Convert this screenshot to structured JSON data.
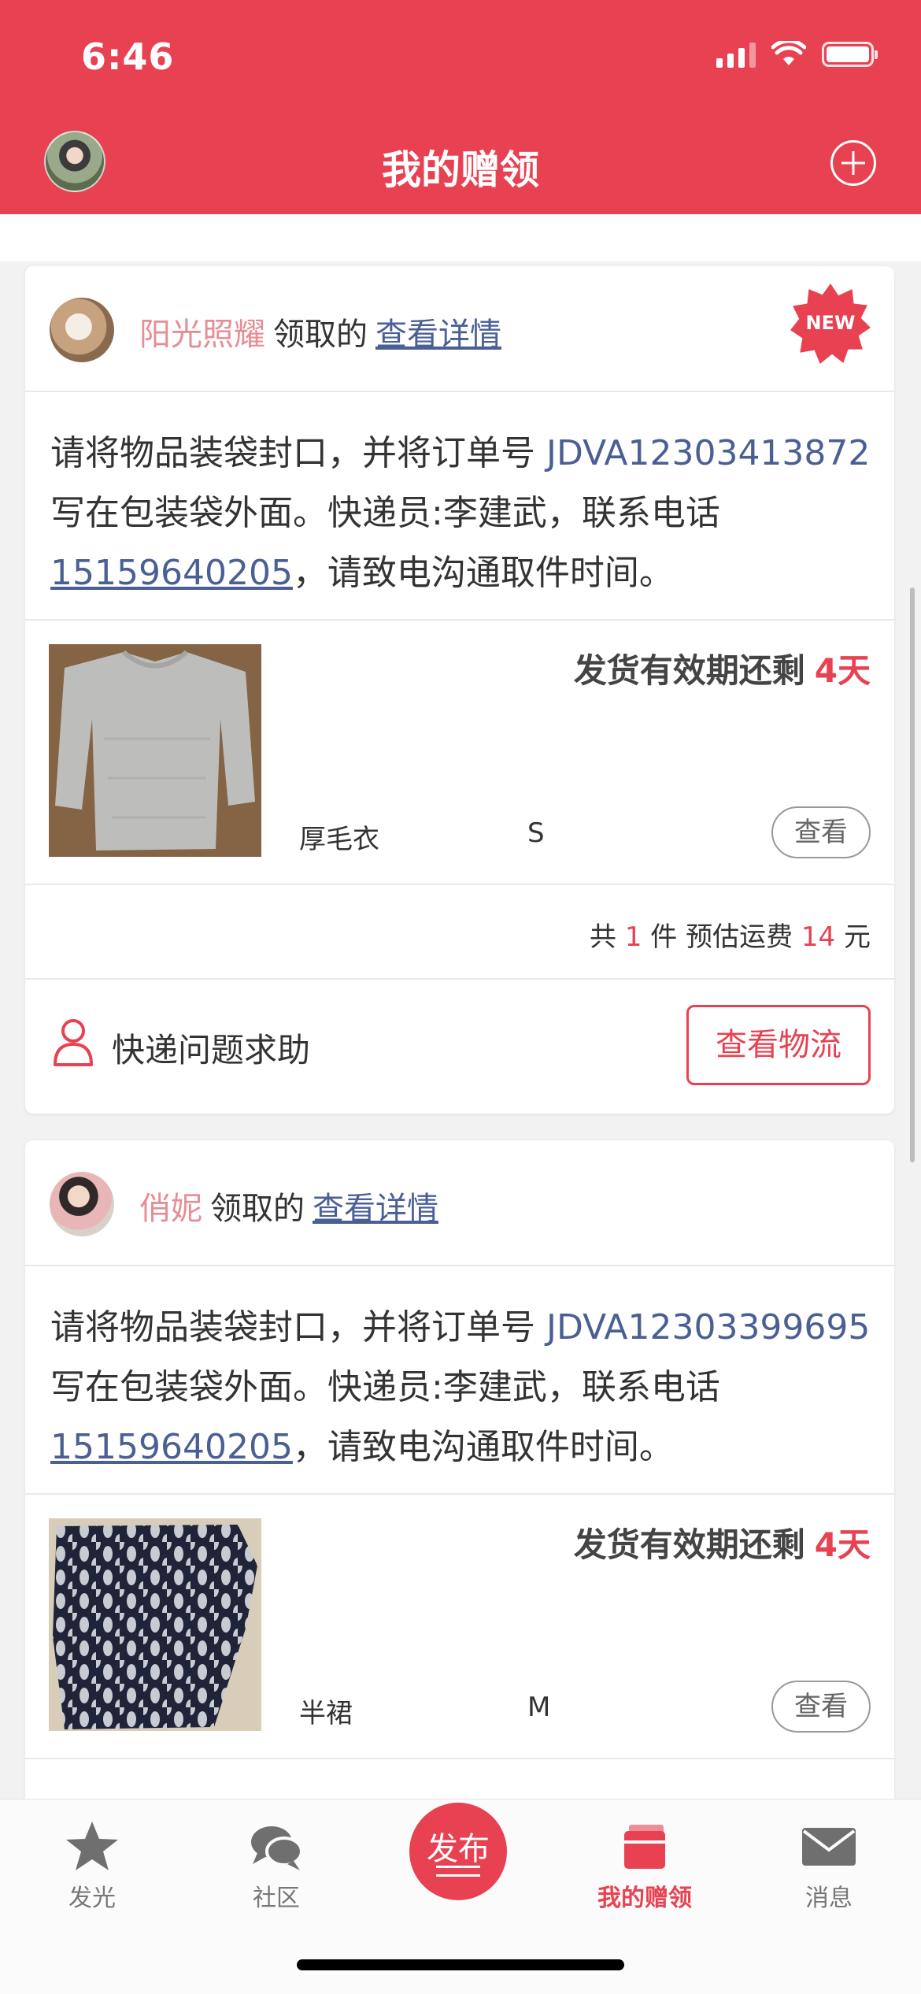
{
  "status_bar": {
    "time": "6:46"
  },
  "header": {
    "title": "我的赠领"
  },
  "cards": [
    {
      "giver": "阳光照耀",
      "claimed": "领取的",
      "detail_link": "查看详情",
      "badge": "NEW",
      "instruction": {
        "prefix": "请将物品装袋封口，并将订单号 ",
        "order_no": "JDVA12303413872",
        "middle": " 写在包装袋外面。快递员:李建武，联系电话",
        "phone": "15159640205",
        "suffix": "，请致电沟通取件时间。"
      },
      "item": {
        "deadline_label": "发货有效期还剩",
        "deadline_days": "4天",
        "name": "厚毛衣",
        "size": "S",
        "view_label": "查看"
      },
      "summary": {
        "prefix": "共 ",
        "count": "1",
        "middle": " 件 预估运费 ",
        "fee": "14",
        "suffix": " 元"
      },
      "help_label": "快递问题求助",
      "logistics_label": "查看物流"
    },
    {
      "giver": "俏妮",
      "claimed": "领取的",
      "detail_link": "查看详情",
      "instruction": {
        "prefix": "请将物品装袋封口，并将订单号 ",
        "order_no": "JDVA12303399695",
        "middle": " 写在包装袋外面。快递员:李建武，联系电话",
        "phone": "15159640205",
        "suffix": "，请致电沟通取件时间。"
      },
      "item": {
        "deadline_label": "发货有效期还剩",
        "deadline_days": "4天",
        "name": "半裙",
        "size": "M",
        "view_label": "查看"
      }
    }
  ],
  "tabbar": {
    "tabs": [
      {
        "label": "发光",
        "icon": "star-icon"
      },
      {
        "label": "社区",
        "icon": "chat-bubbles-icon"
      },
      {
        "label": "发布",
        "icon": "publish-icon"
      },
      {
        "label": "我的赠领",
        "icon": "gift-box-icon",
        "active": true
      },
      {
        "label": "消息",
        "icon": "envelope-icon"
      }
    ]
  },
  "colors": {
    "brand": "#e84252",
    "link": "#4a5f93",
    "giver_name": "#e68d95"
  }
}
